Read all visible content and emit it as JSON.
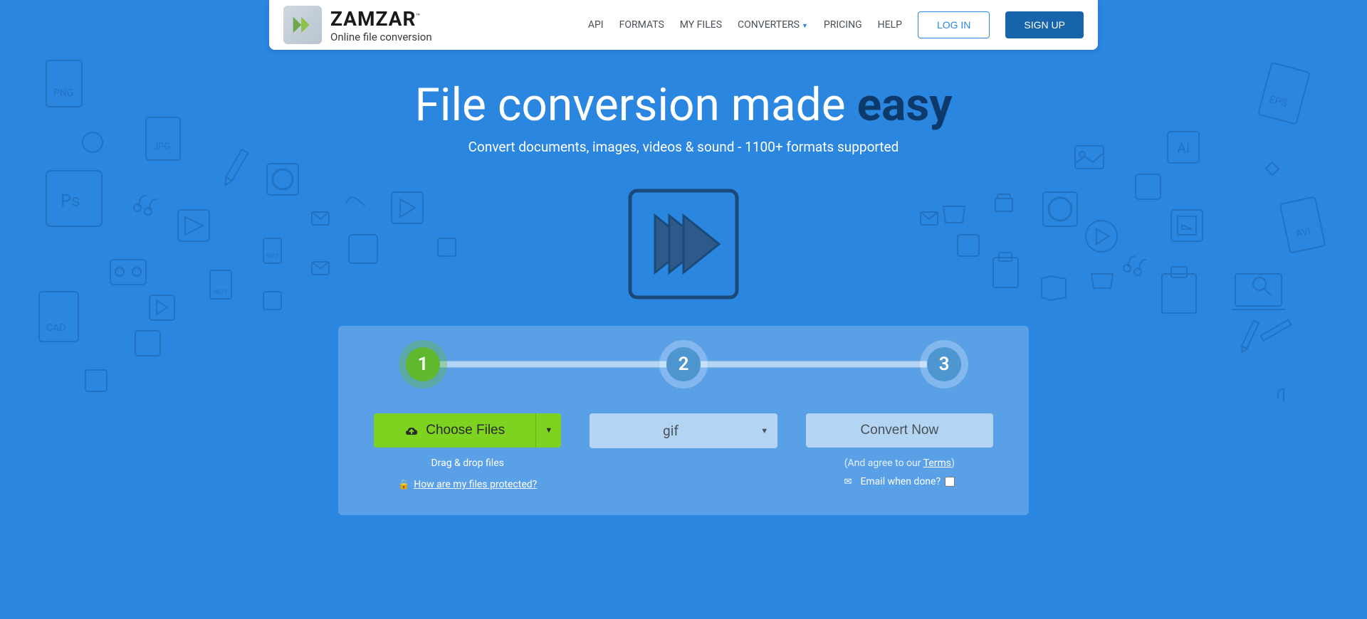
{
  "brand": {
    "name": "ZAMZAR",
    "tm": "™",
    "tagline": "Online file conversion"
  },
  "nav": {
    "api": "API",
    "formats": "FORMATS",
    "myfiles": "MY FILES",
    "converters": "CONVERTERS",
    "pricing": "PRICING",
    "help": "HELP",
    "login": "LOG IN",
    "signup": "SIGN UP"
  },
  "hero": {
    "title_pre": "File conversion made ",
    "title_em": "easy",
    "subtitle": "Convert documents, images, videos & sound - 1100+ formats supported"
  },
  "steps": {
    "one": "1",
    "two": "2",
    "three": "3"
  },
  "actions": {
    "choose": "Choose Files",
    "dragdrop": "Drag & drop files",
    "protected": "How are my files protected?",
    "format_value": "gif",
    "convert": "Convert Now",
    "agree_pre": "(And agree to our ",
    "agree_link": "Terms",
    "agree_post": ")",
    "email_label": "Email when done?"
  }
}
